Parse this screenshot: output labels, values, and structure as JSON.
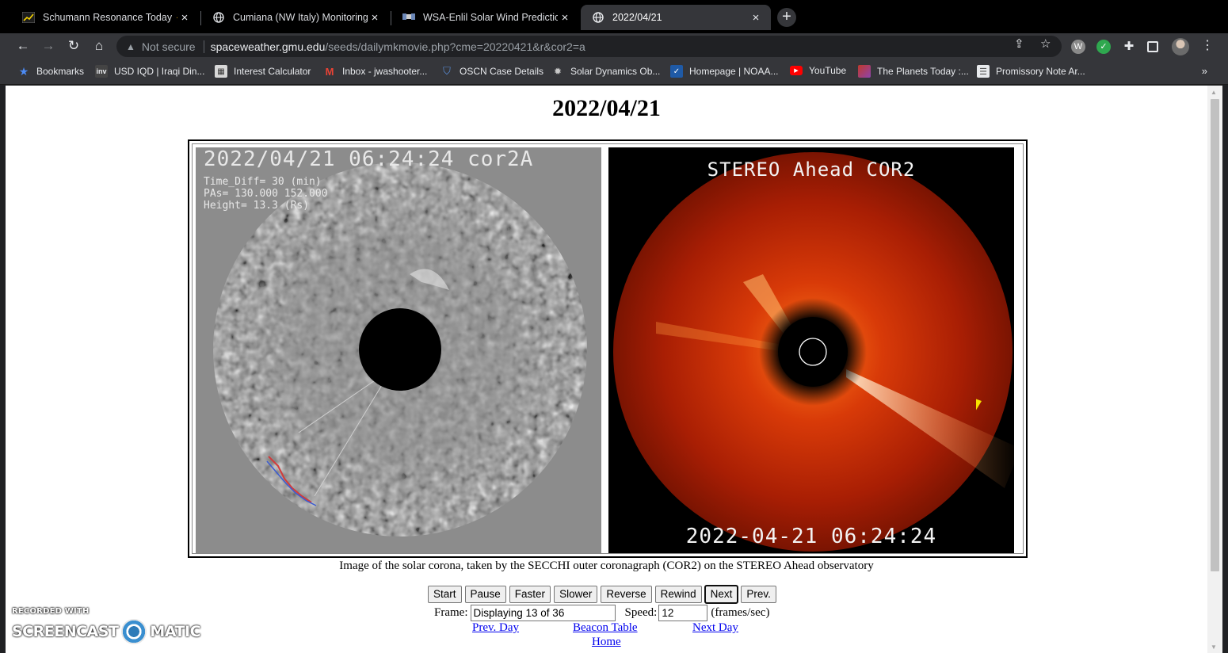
{
  "browser": {
    "tabs": [
      {
        "title": "Schumann Resonance Today ⚡",
        "favicon": "chart-icon",
        "active": false
      },
      {
        "title": "Cumiana (NW Italy) Monitoring S",
        "favicon": "globe-icon",
        "active": false
      },
      {
        "title": "WSA-Enlil Solar Wind Prediction",
        "favicon": "satellite-icon",
        "active": false
      },
      {
        "title": "2022/04/21",
        "favicon": "globe-icon",
        "active": true
      }
    ],
    "new_tab_label": "+",
    "address": {
      "security": "Not secure",
      "host": "spaceweather.gmu.edu",
      "path": "/seeds/dailymkmovie.php?cme=20220421&r&cor2=a"
    },
    "bookmarks": [
      {
        "label": "Bookmarks",
        "icon": "star-icon"
      },
      {
        "label": "USD IQD | Iraqi Din...",
        "icon": "inv-icon"
      },
      {
        "label": "Interest Calculator",
        "icon": "calculator-icon"
      },
      {
        "label": "Inbox - jwashooter...",
        "icon": "gmail-icon"
      },
      {
        "label": "OSCN Case Details",
        "icon": "shield-icon"
      },
      {
        "label": "Solar Dynamics Ob...",
        "icon": "sdo-icon"
      },
      {
        "label": "Homepage | NOAA...",
        "icon": "noaa-icon"
      },
      {
        "label": "YouTube",
        "icon": "youtube-icon"
      },
      {
        "label": "The Planets Today :...",
        "icon": "planets-icon"
      },
      {
        "label": "Promissory Note Ar...",
        "icon": "document-icon"
      }
    ],
    "bookmarks_overflow": "»"
  },
  "page": {
    "title": "2022/04/21",
    "left_image": {
      "overlay_title": "2022/04/21 06:24:24 cor2A",
      "time_diff": "Time_Diff= 30 (min)",
      "pas": "PAs=  130.000 152.000",
      "height": "Height=  13.3 (Rs)"
    },
    "right_image": {
      "title": "STEREO Ahead COR2",
      "timestamp": "2022-04-21 06:24:24"
    },
    "caption": "Image of the solar corona, taken by the SECCHI outer coronagraph (COR2) on the STEREO Ahead observatory",
    "controls": {
      "start": "Start",
      "pause": "Pause",
      "faster": "Faster",
      "slower": "Slower",
      "reverse": "Reverse",
      "rewind": "Rewind",
      "next": "Next",
      "prev": "Prev."
    },
    "frame_label": "Frame:",
    "frame_value": "Displaying 13 of 36",
    "speed_label": "Speed:",
    "speed_value": "12",
    "speed_unit": "(frames/sec)",
    "links": {
      "prev_day": "Prev. Day ",
      "beacon_table": "Beacon Table",
      "next_day": "Next Day",
      "home": "Home"
    }
  },
  "watermark": {
    "recorded": "RECORDED WITH",
    "brand_left": "SCREENCAST",
    "brand_right": "MATIC"
  }
}
